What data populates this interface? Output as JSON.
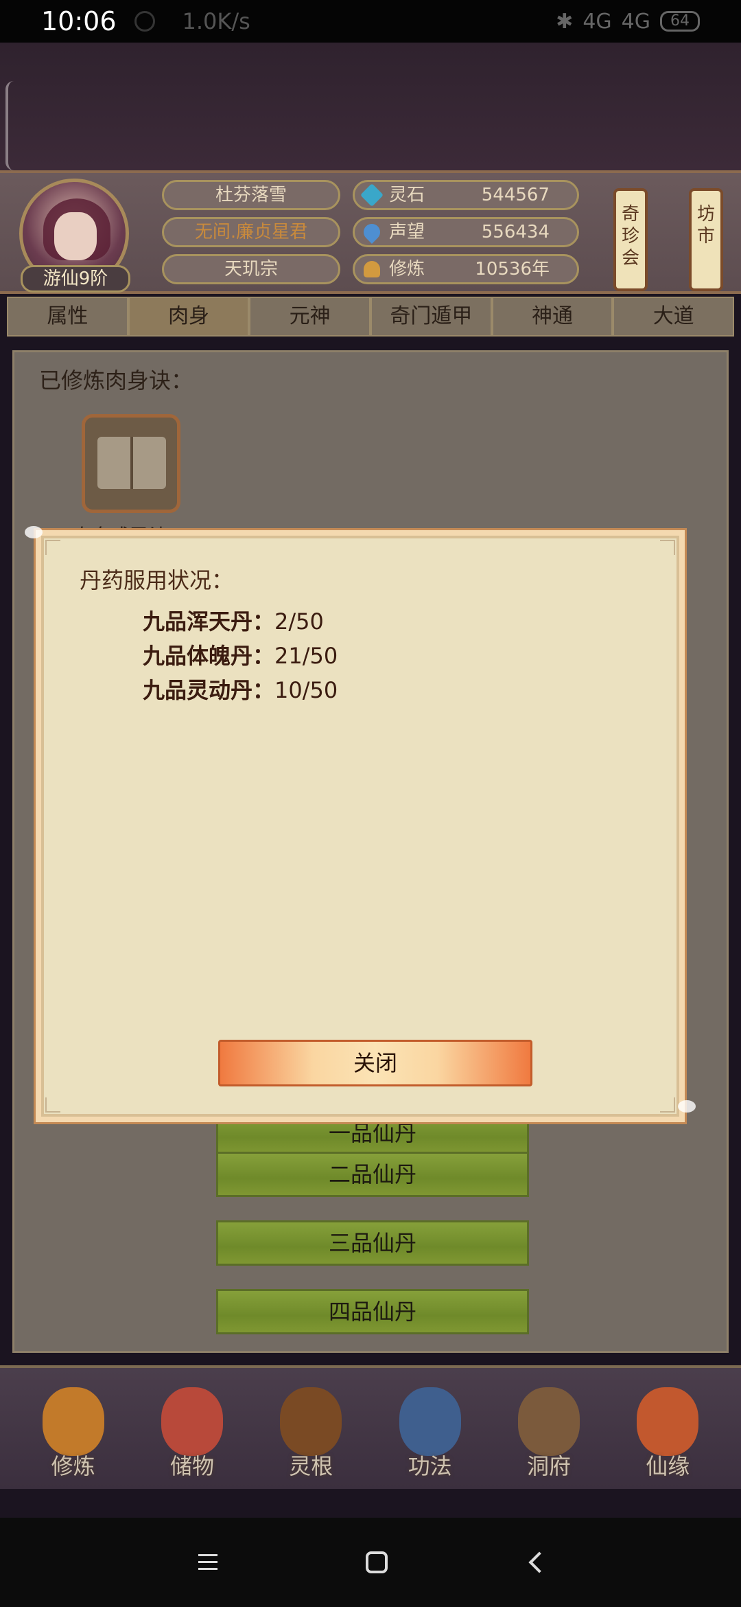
{
  "status_bar": {
    "time": "10:06",
    "net_speed": "1.0K/s",
    "signal_1": "4G",
    "signal_2": "4G",
    "battery": "64"
  },
  "profile": {
    "player_name": "杜芬落雪",
    "player_title": "无间.廉贞星君",
    "sect": "天玑宗",
    "realm_badge": "游仙9阶",
    "stats": [
      {
        "label": "灵石",
        "value": "544567",
        "icon": "spirit-stone-icon"
      },
      {
        "label": "声望",
        "value": "556434",
        "icon": "prestige-icon"
      },
      {
        "label": "修炼",
        "value": "10536年",
        "icon": "cultivation-icon"
      }
    ],
    "scroll_buttons": [
      {
        "label": "奇珍会",
        "name": "treasure-auction-button"
      },
      {
        "label": "坊市",
        "name": "market-button"
      }
    ]
  },
  "tabs": [
    {
      "label": "属性",
      "active": false
    },
    {
      "label": "肉身",
      "active": true
    },
    {
      "label": "元神",
      "active": false
    },
    {
      "label": "奇门遁甲",
      "active": false
    },
    {
      "label": "神通",
      "active": false
    },
    {
      "label": "大道",
      "active": false
    }
  ],
  "panel": {
    "section_title": "已修炼肉身诀：",
    "book_label": "肉身成圣诀",
    "buttons": [
      "一品仙丹",
      "二品仙丹",
      "三品仙丹",
      "四品仙丹"
    ]
  },
  "modal": {
    "heading": "丹药服用状况：",
    "rows": [
      {
        "name": "九品浑天丹：",
        "value": "2/50"
      },
      {
        "name": "九品体魄丹：",
        "value": "21/50"
      },
      {
        "name": "九品灵动丹：",
        "value": "10/50"
      }
    ],
    "close_label": "关闭"
  },
  "bottom_nav": [
    {
      "label": "修炼",
      "color": "#c27a2a"
    },
    {
      "label": "储物",
      "color": "#b8493a"
    },
    {
      "label": "灵根",
      "color": "#7a4a24"
    },
    {
      "label": "功法",
      "color": "#3f5f8e"
    },
    {
      "label": "洞府",
      "color": "#7b5a3c"
    },
    {
      "label": "仙缘",
      "color": "#c2582e"
    }
  ]
}
